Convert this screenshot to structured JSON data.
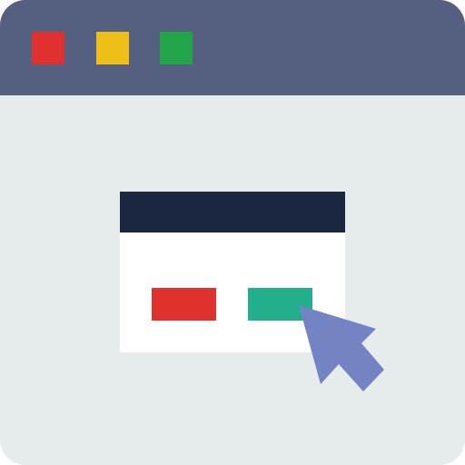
{
  "colors": {
    "titlebar": "#556080",
    "content_bg": "#E6ECEC",
    "close": "#E0312F",
    "minimize": "#EEBF17",
    "maximize": "#22A449",
    "dialog_header": "#1B2640",
    "dialog_bg": "#FFFFFF",
    "btn_cancel": "#E0312F",
    "btn_confirm": "#22AF8C",
    "cursor": "#7383C4"
  },
  "window_controls": {
    "close_icon": "square",
    "minimize_icon": "square",
    "maximize_icon": "square"
  },
  "cursor_icon": "arrow-pointer-icon"
}
